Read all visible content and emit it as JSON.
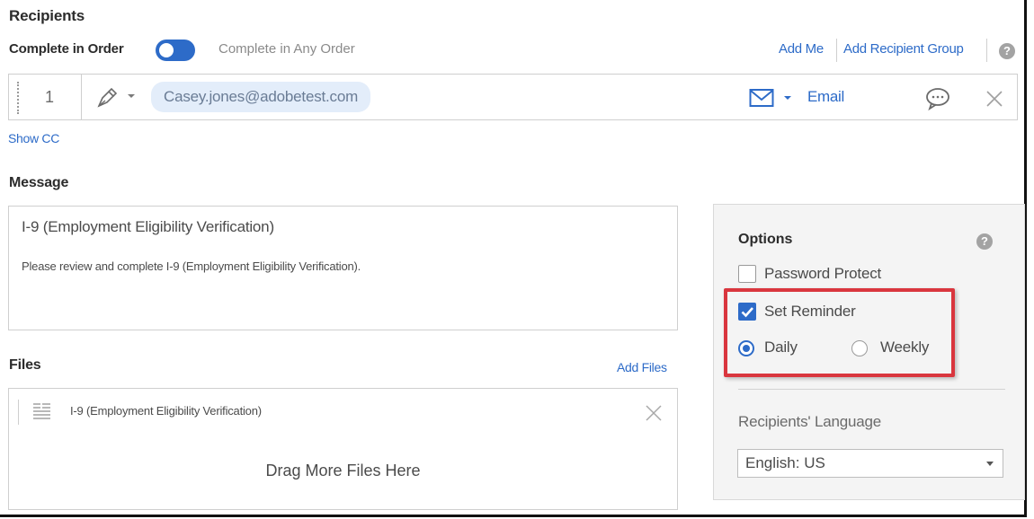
{
  "recipients": {
    "heading": "Recipients",
    "order_on": "Complete in Order",
    "order_off": "Complete in Any Order",
    "add_me": "Add Me",
    "add_group": "Add Recipient Group",
    "row": {
      "number": "1",
      "email": "Casey.jones@adobetest.com",
      "delivery": "Email"
    },
    "show_cc": "Show CC"
  },
  "message": {
    "heading": "Message",
    "subject": "I-9 (Employment Eligibility Verification)",
    "body": "Please review and complete I-9 (Employment Eligibility Verification)."
  },
  "files": {
    "heading": "Files",
    "add_files": "Add Files",
    "items": [
      "I-9 (Employment Eligibility Verification)"
    ],
    "drop_zone": "Drag More Files Here"
  },
  "options": {
    "heading": "Options",
    "password_protect": "Password Protect",
    "set_reminder": "Set Reminder",
    "daily": "Daily",
    "weekly": "Weekly",
    "language_label": "Recipients' Language",
    "language_value": "English: US"
  },
  "help_glyph": "?",
  "colors": {
    "accent": "#2d6bc8",
    "highlight": "#d9363e",
    "pill": "#e3edfa"
  },
  "icons": [
    "pen-icon",
    "envelope-icon",
    "comment-icon",
    "close-icon",
    "document-icon",
    "help-icon"
  ]
}
